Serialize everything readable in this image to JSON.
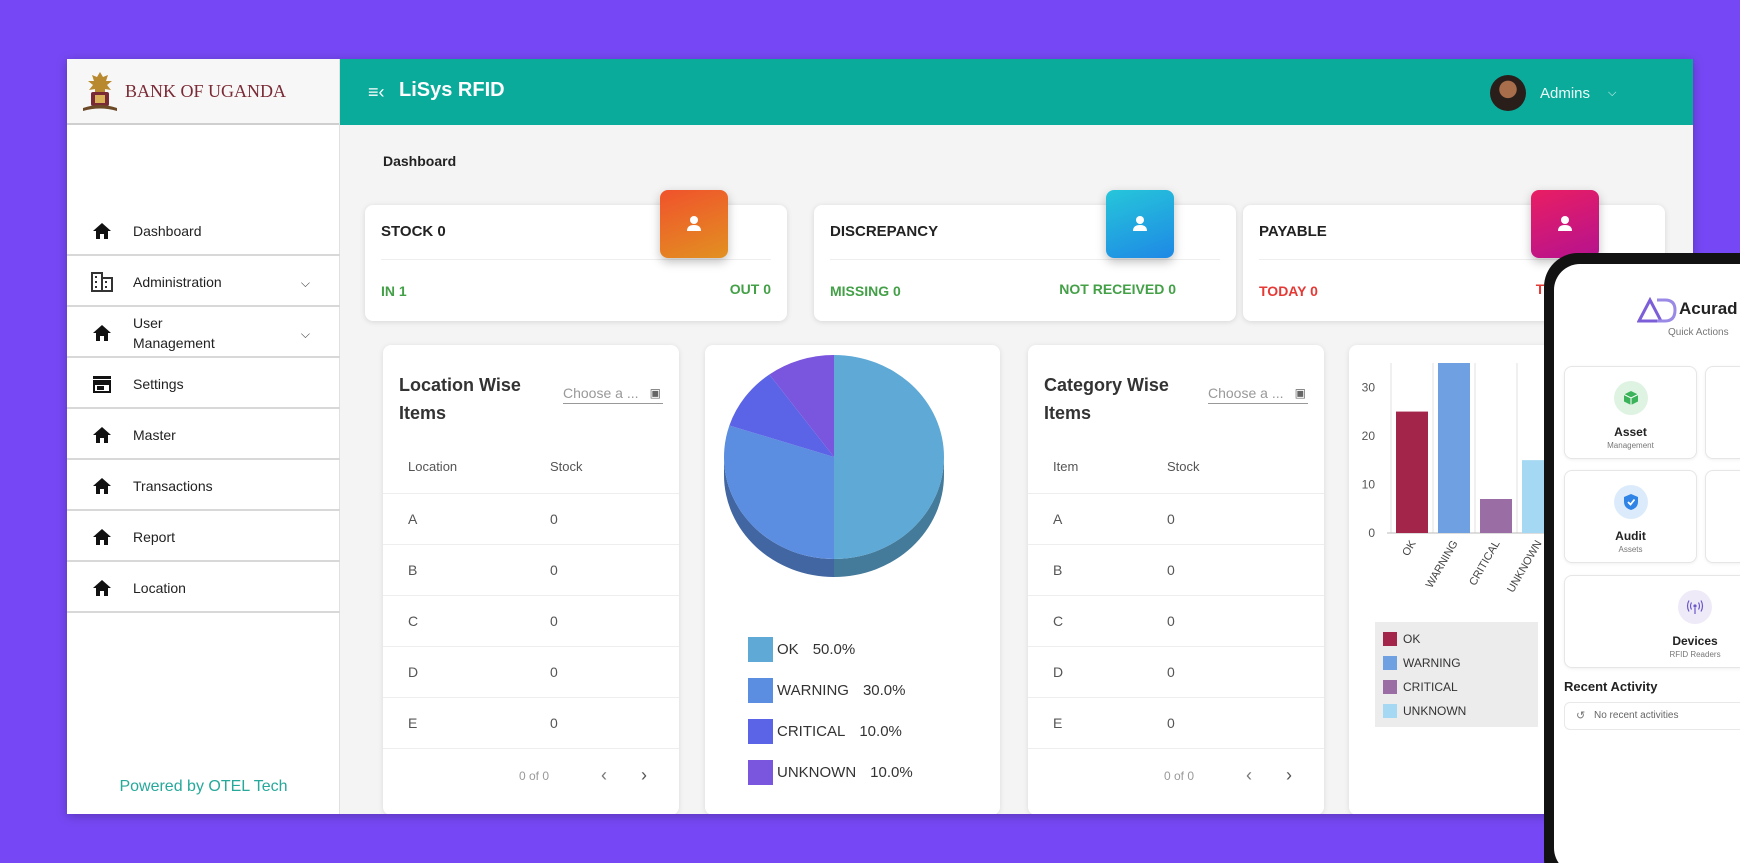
{
  "brand": {
    "name": "BANK OF UGANDA"
  },
  "header": {
    "app_title": "LiSys RFID",
    "user": "Admins"
  },
  "breadcrumb": "Dashboard",
  "sidebar": {
    "items": [
      {
        "label": "Dashboard",
        "icon": "home-icon"
      },
      {
        "label": "Administration",
        "icon": "building-icon",
        "expandable": true
      },
      {
        "label": "User\nManagement",
        "icon": "home-icon",
        "expandable": true
      },
      {
        "label": "Settings",
        "icon": "store-icon"
      },
      {
        "label": "Master",
        "icon": "home-icon"
      },
      {
        "label": "Transactions",
        "icon": "home-icon"
      },
      {
        "label": "Report",
        "icon": "home-icon"
      },
      {
        "label": "Location",
        "icon": "home-icon"
      }
    ],
    "footer": "Powered by OTEL Tech"
  },
  "stats": [
    {
      "title": "STOCK  0",
      "left_label": "IN  1",
      "right_label": "OUT  0",
      "left_color": "#43a047",
      "right_color": "#43a047",
      "badge_colors": [
        "#f0522c",
        "#e29121"
      ],
      "icon": "user-icon"
    },
    {
      "title": "DISCREPANCY",
      "left_label": "MISSING  0",
      "right_label": "NOT RECEIVED  0",
      "left_color": "#43a047",
      "right_color": "#43a047",
      "badge_colors": [
        "#26c6da",
        "#1e88e5"
      ],
      "icon": "user-icon"
    },
    {
      "title": "PAYABLE",
      "left_label": "TODAY    0",
      "right_label": "TO",
      "left_color": "#e53935",
      "right_color": "#e53935",
      "badge_colors": [
        "#e91e63",
        "#b5128f"
      ],
      "icon": "user-icon"
    }
  ],
  "location_panel": {
    "title": "Location Wise Items",
    "choose_placeholder": "Choose a ...",
    "columns": [
      "Location",
      "Stock"
    ],
    "rows": [
      [
        "A",
        "0"
      ],
      [
        "B",
        "0"
      ],
      [
        "C",
        "0"
      ],
      [
        "D",
        "0"
      ],
      [
        "E",
        "0"
      ]
    ],
    "pager": "0 of 0"
  },
  "category_panel": {
    "title": "Category Wise Items",
    "choose_placeholder": "Choose a ...",
    "columns": [
      "Item",
      "Stock"
    ],
    "rows": [
      [
        "A",
        "0"
      ],
      [
        "B",
        "0"
      ],
      [
        "C",
        "0"
      ],
      [
        "D",
        "0"
      ],
      [
        "E",
        "0"
      ]
    ],
    "pager": "0 of 0"
  },
  "chart_data": [
    {
      "type": "pie",
      "categories": [
        "OK",
        "WARNING",
        "CRITICAL",
        "UNKNOWN"
      ],
      "values": [
        50.0,
        30.0,
        10.0,
        10.0
      ],
      "labels": [
        "50.0%",
        "30.0%",
        "10.0%",
        "10.0%"
      ],
      "colors": [
        "#5ea9d6",
        "#5b8de0",
        "#5b63e6",
        "#7a55dd"
      ],
      "legend_position": "bottom"
    },
    {
      "type": "bar",
      "categories": [
        "OK",
        "WARNING",
        "CRITICAL",
        "UNKNOWN"
      ],
      "values": [
        25,
        35,
        7,
        15
      ],
      "colors": [
        "#a3254a",
        "#6fa0e2",
        "#9a6da4",
        "#a5d8f3"
      ],
      "ylim": [
        0,
        35
      ],
      "yticks": [
        0,
        10,
        20,
        30
      ],
      "grid": true,
      "legend_position": "bottom"
    }
  ],
  "phone": {
    "brand": "Acurad",
    "subtitle": "Quick Actions",
    "cards": [
      {
        "title": "Asset",
        "sub": "Management",
        "icon": "box-icon"
      },
      {
        "title": "Audit",
        "sub": "Assets",
        "icon": "shield-check-icon"
      },
      {
        "title": "Devices",
        "sub": "RFID Readers",
        "icon": "antenna-icon"
      }
    ],
    "recent_title": "Recent Activity",
    "recent_empty": "No recent activities"
  }
}
